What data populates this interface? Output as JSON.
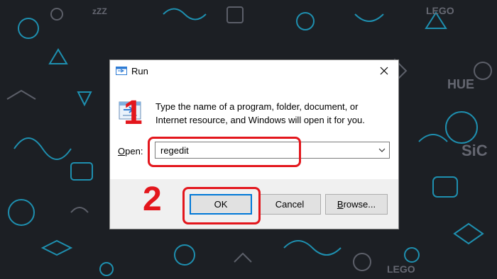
{
  "dialog": {
    "title": "Run",
    "title_icon": "run-app-icon",
    "close_icon": "close-icon",
    "description_line1": "Type the name of a program, folder, document, or",
    "description_line2": "Internet resource, and Windows will open it for you.",
    "open_label_accel": "O",
    "open_label_rest": "pen:",
    "open_value": "regedit",
    "ok_label": "OK",
    "cancel_label": "Cancel",
    "browse_accel": "B",
    "browse_rest": "rowse..."
  },
  "annotations": {
    "step1": "1",
    "step2": "2",
    "highlight_color": "#e3161c"
  },
  "wallpaper": {
    "background": "#1c1f24",
    "doodle_colors": [
      "#1fa3c8",
      "#2bc0d8",
      "#6d6f7a"
    ]
  }
}
